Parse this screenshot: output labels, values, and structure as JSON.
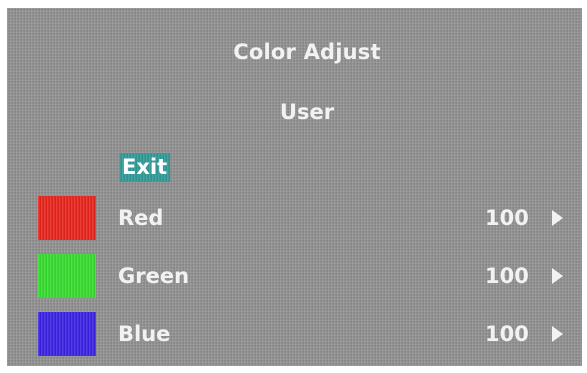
{
  "osd": {
    "title": "Color Adjust",
    "subtitle": "User",
    "exit_label": "Exit",
    "items": [
      {
        "label": "Red",
        "value": "100",
        "swatch_color": "#e8241b",
        "arrow_icon": "arrow-right-icon"
      },
      {
        "label": "Green",
        "value": "100",
        "swatch_color": "#36dd2e",
        "arrow_icon": "arrow-right-icon"
      },
      {
        "label": "Blue",
        "value": "100",
        "swatch_color": "#3a22e6",
        "arrow_icon": "arrow-right-icon"
      }
    ],
    "colors": {
      "background": "#8d8d8d",
      "highlight": "#2f9a97",
      "text": "#f2f2f2"
    }
  }
}
